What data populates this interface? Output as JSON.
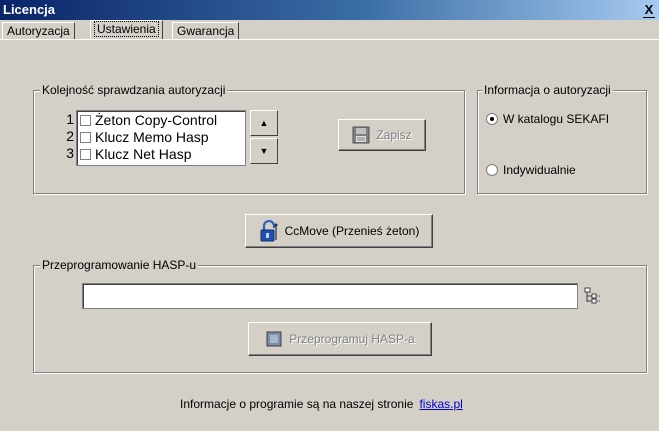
{
  "window": {
    "title": "Licencja",
    "close_label": "X"
  },
  "tabs": [
    {
      "label": "Autoryzacja",
      "active": false
    },
    {
      "label": "Ustawienia",
      "active": true
    },
    {
      "label": "Gwarancja",
      "active": false
    }
  ],
  "auth_order": {
    "legend": "Kolejność sprawdzania autoryzacji",
    "items": [
      {
        "num": "1",
        "label": "Żeton Copy-Control",
        "checked": false
      },
      {
        "num": "2",
        "label": "Klucz Memo Hasp",
        "checked": false
      },
      {
        "num": "3",
        "label": "Klucz Net Hasp",
        "checked": false
      }
    ],
    "save_label": "Zapisz"
  },
  "auth_info": {
    "legend": "Informacja o autoryzacji",
    "options": [
      {
        "label": "W katalogu SEKAFI",
        "selected": true
      },
      {
        "label": "Indywidualnie",
        "selected": false
      }
    ]
  },
  "ccmove_label": "CcMove (Przenieś żeton)",
  "hasp": {
    "legend": "Przeprogramowanie HASP-u",
    "input_value": "",
    "reprogram_label": "Przeprogramuj HASP-a"
  },
  "footer": {
    "text": "Informacje o programie są na naszej stronie",
    "link": "fiskas.pl"
  },
  "colors": {
    "titlebar": "#0a246a",
    "face": "#d4d0c8",
    "link": "#0000cc"
  }
}
